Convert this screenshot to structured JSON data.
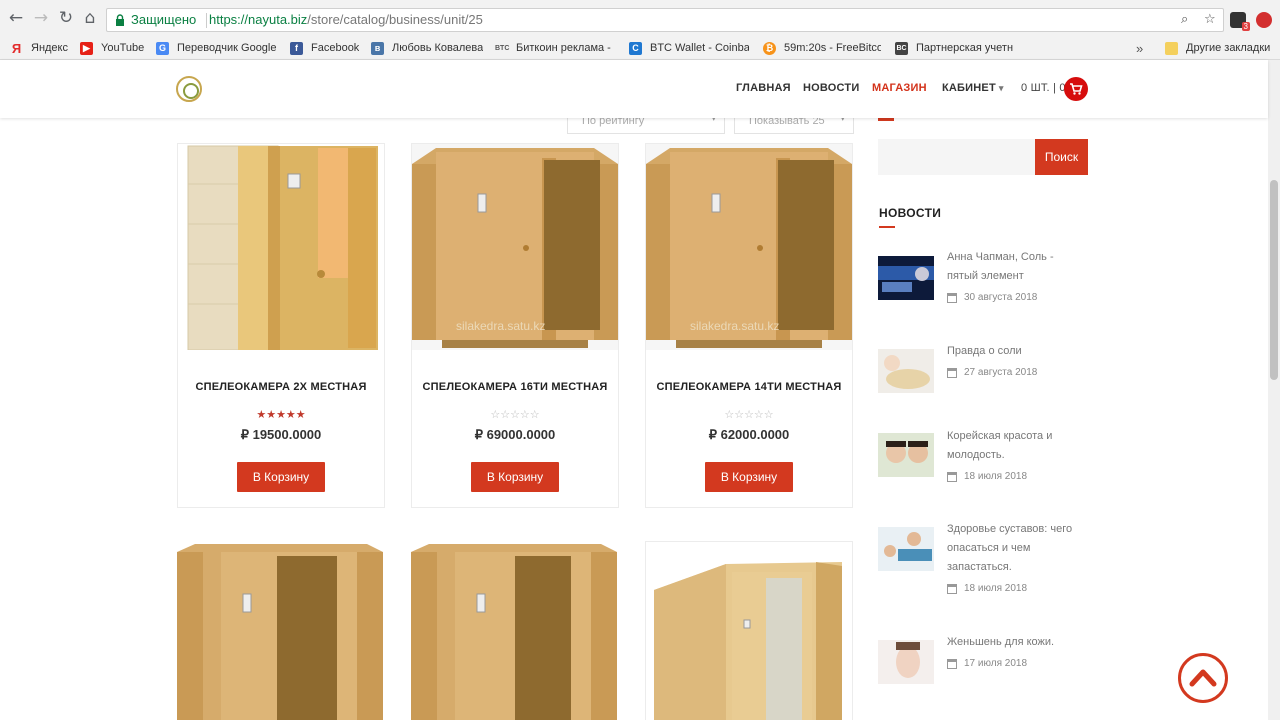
{
  "browser": {
    "secure_label": "Защищено",
    "url_host": "https://nayuta.biz",
    "url_path": "/store/catalog/business/unit/25",
    "ext_badge": "3"
  },
  "bookmarks": [
    {
      "label": "Яндекс",
      "icon": "yandex-icon",
      "color": "#e32c2c"
    },
    {
      "label": "YouTube",
      "icon": "youtube-icon",
      "color": "#e62117"
    },
    {
      "label": "Переводчик Google",
      "icon": "google-translate-icon",
      "color": "#4a8af4"
    },
    {
      "label": "Facebook",
      "icon": "facebook-icon",
      "color": "#3b5998"
    },
    {
      "label": "Любовь Ковалева",
      "icon": "vk-icon",
      "color": "#4a76a8"
    },
    {
      "label": "Биткоин реклама -",
      "icon": "btc-text-icon",
      "color": "#555555"
    },
    {
      "label": "BTC Wallet - Coinba",
      "icon": "coinbase-icon",
      "color": "#1f78d1"
    },
    {
      "label": "59m:20s - FreeBitco",
      "icon": "bitcoin-icon",
      "color": "#f7931a"
    },
    {
      "label": "Партнерская учетн",
      "icon": "bc-icon",
      "color": "#444444"
    },
    {
      "label": "Другие закладки",
      "icon": "folder-icon",
      "color": "#f4d05d"
    }
  ],
  "nav": {
    "home": "ГЛАВНАЯ",
    "news": "НОВОСТИ",
    "shop": "МАГАЗИН",
    "cabinet": "КАБИНЕТ",
    "cart_summary": "0 ШТ. | 0",
    "accent": "#d3321a"
  },
  "sort": {
    "order_label": "По рейтингу",
    "show_label": "Показывать 25"
  },
  "products": [
    {
      "title": "СПЕЛЕОКАМЕРА 2Х МЕСТНАЯ",
      "rating": 4.5,
      "stars": "★★★★★",
      "price": "₽ 19500.0000",
      "button": "В Корзину"
    },
    {
      "title": "СПЕЛЕОКАМЕРА 16ТИ МЕСТНАЯ",
      "rating": 0,
      "stars": "☆☆☆☆☆",
      "price": "₽ 69000.0000",
      "button": "В Корзину",
      "watermark": "silakedra.satu.kz"
    },
    {
      "title": "СПЕЛЕОКАМЕРА 14ТИ МЕСТНАЯ",
      "rating": 0,
      "stars": "☆☆☆☆☆",
      "price": "₽ 62000.0000",
      "button": "В Корзину",
      "watermark": "silakedra.satu.kz"
    }
  ],
  "sidebar": {
    "search_button": "Поиск",
    "news_heading": "НОВОСТИ",
    "news": [
      {
        "title": "Анна Чапман, Соль - пятый элемент",
        "date": "30 августа 2018"
      },
      {
        "title": "Правда о соли",
        "date": "27 августа 2018"
      },
      {
        "title": "Корейская красота и молодость.",
        "date": "18 июля 2018"
      },
      {
        "title": "Здоровье суставов: чего опасаться и чем запастаться.",
        "date": "18 июля 2018"
      },
      {
        "title": "Женьшень для кожи.",
        "date": "17 июля 2018"
      }
    ]
  }
}
